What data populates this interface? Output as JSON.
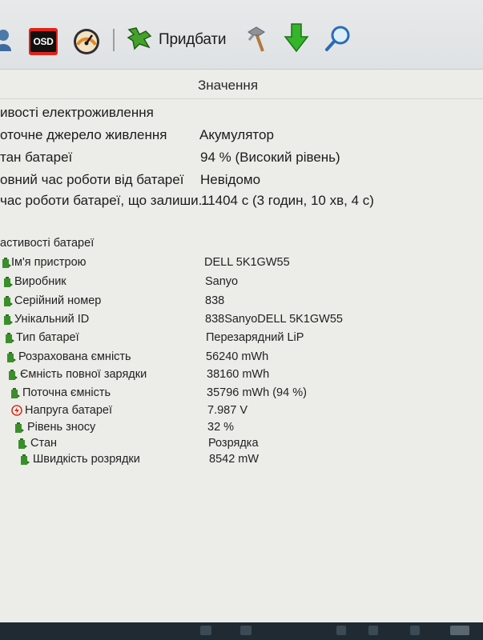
{
  "toolbar": {
    "osd_label": "OSD",
    "add_label": "Придбати"
  },
  "table": {
    "value_header": "Значення"
  },
  "power": {
    "section_title": "ивості електроживлення",
    "rows": [
      {
        "name": "оточне джерело живлення",
        "value": "Акумулятор"
      },
      {
        "name": "тан батареї",
        "value": "94 % (Високий рівень)"
      },
      {
        "name": "овний час роботи від батареї",
        "value": "Невідомо"
      },
      {
        "name": "час роботи батареї, що залиши...",
        "value": "11404 с (3 годин, 10 хв, 4 с)"
      }
    ]
  },
  "battery": {
    "section_title": "астивості батареї",
    "rows": [
      {
        "name": "Ім'я пристрою",
        "value": "DELL 5K1GW55",
        "icon": "battery-icon"
      },
      {
        "name": "Виробник",
        "value": "Sanyo",
        "icon": "battery-icon"
      },
      {
        "name": "Серійний номер",
        "value": "838",
        "icon": "battery-icon"
      },
      {
        "name": "Унікальний ID",
        "value": "838SanyoDELL 5K1GW55",
        "icon": "battery-icon"
      },
      {
        "name": "Тип батареї",
        "value": "Перезарядний LiP",
        "icon": "battery-icon"
      },
      {
        "name": "Розрахована ємність",
        "value": "56240 mWh",
        "icon": "battery-icon"
      },
      {
        "name": "Ємність повної зарядки",
        "value": "38160 mWh",
        "icon": "battery-icon"
      },
      {
        "name": "Поточна ємність",
        "value": "35796 mWh  (94 %)",
        "icon": "battery-icon"
      },
      {
        "name": "Напруга батареї",
        "value": "7.987 V",
        "icon": "voltage-icon"
      },
      {
        "name": "Рівень зносу",
        "value": "32 %",
        "icon": "battery-icon"
      },
      {
        "name": "Стан",
        "value": "Розрядка",
        "icon": "battery-icon"
      },
      {
        "name": "Швидкість розрядки",
        "value": "8542 mW",
        "icon": "battery-icon"
      }
    ]
  },
  "colors": {
    "battery_green": "#3a8f2a",
    "voltage_red": "#d4301e",
    "osd_red": "#e2231a",
    "toolbar_bg": "#e1e4e6",
    "content_bg": "#ecece9"
  }
}
